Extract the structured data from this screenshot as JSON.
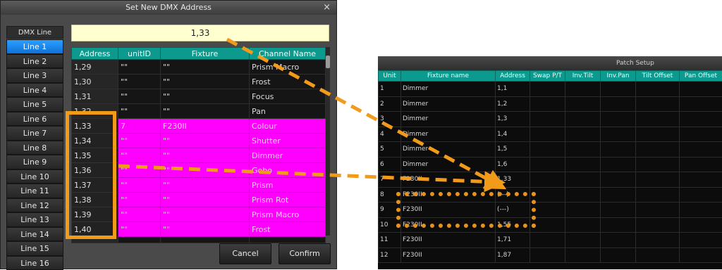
{
  "dialog": {
    "title": "Set New DMX Address",
    "close": "×",
    "dmx_line_header": "DMX Line",
    "address_value": "1,33",
    "lines": [
      "Line 1",
      "Line 2",
      "Line 3",
      "Line 4",
      "Line 5",
      "Line 6",
      "Line 7",
      "Line 8",
      "Line 9",
      "Line 10",
      "Line 11",
      "Line 12",
      "Line 13",
      "Line 14",
      "Line 15",
      "Line 16"
    ],
    "columns": [
      "Address",
      "unitID",
      "Fixture",
      "Channel Name"
    ],
    "rows": [
      [
        "1,29",
        "\"\"",
        "\"\"",
        "Prism Macro"
      ],
      [
        "1,30",
        "\"\"",
        "\"\"",
        "Frost"
      ],
      [
        "1,31",
        "\"\"",
        "\"\"",
        "Focus"
      ],
      [
        "1,32",
        "\"\"",
        "\"\"",
        "Pan"
      ],
      [
        "1,33",
        "7",
        "F230II",
        "Colour"
      ],
      [
        "1,34",
        "\"\"",
        "\"\"",
        "Shutter"
      ],
      [
        "1,35",
        "\"\"",
        "\"\"",
        "Dimmer"
      ],
      [
        "1,36",
        "\"\"",
        "\"\"",
        "Gobo"
      ],
      [
        "1,37",
        "\"\"",
        "\"\"",
        "Prism"
      ],
      [
        "1,38",
        "\"\"",
        "\"\"",
        "Prism Rot"
      ],
      [
        "1,39",
        "\"\"",
        "\"\"",
        "Prism Macro"
      ],
      [
        "1,40",
        "\"\"",
        "\"\"",
        "Frost"
      ],
      [
        "",
        "",
        "",
        ""
      ]
    ],
    "cancel_label": "Cancel",
    "confirm_label": "Confirm"
  },
  "patch": {
    "title": "Patch Setup",
    "columns": [
      "Unit",
      "Fixture name",
      "Address",
      "Swap P/T",
      "Inv.Tilt",
      "Inv.Pan",
      "Tilt Offset",
      "Pan Offset"
    ],
    "rows": [
      [
        "1",
        "Dimmer",
        "1,1"
      ],
      [
        "2",
        "Dimmer",
        "1,2"
      ],
      [
        "3",
        "Dimmer",
        "1,3"
      ],
      [
        "4",
        "Dimmer",
        "1,4"
      ],
      [
        "5",
        "Dimmer",
        "1,5"
      ],
      [
        "6",
        "Dimmer",
        "1,6"
      ],
      [
        "7",
        "F230II",
        "1,33"
      ],
      [
        "8",
        "F230II",
        "(---)"
      ],
      [
        "9",
        "F230II",
        "(---)"
      ],
      [
        "10",
        "F230II",
        "1,55"
      ],
      [
        "11",
        "F230II",
        "1,71"
      ],
      [
        "12",
        "F230II",
        "1,87"
      ]
    ]
  },
  "colors": {
    "highlight_orange": "#f29a1a",
    "header_teal": "#0d9a8e",
    "selected_rows_magenta": "#ff00ff",
    "active_line_blue": "#1f8fff"
  }
}
